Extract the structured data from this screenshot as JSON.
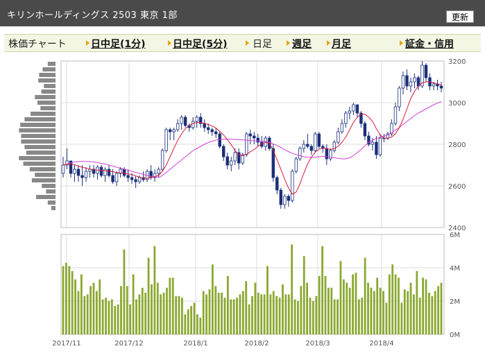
{
  "header": {
    "title": "キリンホールディングス  2503  東京 1部",
    "refresh_label": "更新"
  },
  "tabs": {
    "label": "株価チャート",
    "intraday_1": "日中足(1分)",
    "intraday_5": "日中足(5分)",
    "daily": "日足",
    "weekly": "週足",
    "monthly": "月足",
    "margin": "証金・信用"
  },
  "colors": {
    "up": "#ffffff",
    "down": "#1a2f7a",
    "ma_short": "#d81b3a",
    "ma_long": "#d13ed8",
    "volume": "#8aa830",
    "profile": "#888888"
  },
  "chart_data": {
    "type": "candlestick",
    "price_axis": {
      "ylim": [
        2400,
        3200
      ],
      "ticks": [
        "3200",
        "3000",
        "2800",
        "2600",
        "2400"
      ]
    },
    "volume_axis": {
      "ylim": [
        0,
        6000000
      ],
      "ticks": [
        "6M",
        "4M",
        "2M",
        "0M"
      ]
    },
    "x_ticks": [
      "2017/11",
      "2017/12",
      "2018/1",
      "2018/2",
      "2018/3",
      "2018/4"
    ],
    "ohlc": [
      [
        2660,
        2740,
        2640,
        2700
      ],
      [
        2700,
        2780,
        2680,
        2720
      ],
      [
        2720,
        2720,
        2640,
        2660
      ],
      [
        2660,
        2700,
        2620,
        2680
      ],
      [
        2680,
        2700,
        2620,
        2650
      ],
      [
        2650,
        2700,
        2600,
        2640
      ],
      [
        2640,
        2690,
        2620,
        2670
      ],
      [
        2670,
        2700,
        2640,
        2680
      ],
      [
        2680,
        2700,
        2640,
        2660
      ],
      [
        2660,
        2700,
        2630,
        2690
      ],
      [
        2690,
        2700,
        2640,
        2650
      ],
      [
        2650,
        2690,
        2620,
        2680
      ],
      [
        2680,
        2700,
        2640,
        2650
      ],
      [
        2650,
        2680,
        2610,
        2620
      ],
      [
        2620,
        2670,
        2600,
        2660
      ],
      [
        2660,
        2690,
        2640,
        2680
      ],
      [
        2680,
        2690,
        2640,
        2650
      ],
      [
        2650,
        2680,
        2620,
        2640
      ],
      [
        2640,
        2660,
        2610,
        2630
      ],
      [
        2630,
        2650,
        2590,
        2620
      ],
      [
        2620,
        2650,
        2610,
        2640
      ],
      [
        2640,
        2670,
        2620,
        2630
      ],
      [
        2630,
        2680,
        2620,
        2670
      ],
      [
        2670,
        2700,
        2630,
        2640
      ],
      [
        2640,
        2680,
        2620,
        2660
      ],
      [
        2660,
        2690,
        2640,
        2680
      ],
      [
        2680,
        2780,
        2670,
        2770
      ],
      [
        2770,
        2880,
        2760,
        2870
      ],
      [
        2870,
        2880,
        2820,
        2860
      ],
      [
        2860,
        2880,
        2820,
        2870
      ],
      [
        2870,
        2920,
        2860,
        2900
      ],
      [
        2900,
        2940,
        2870,
        2930
      ],
      [
        2930,
        2940,
        2880,
        2890
      ],
      [
        2890,
        2900,
        2860,
        2880
      ],
      [
        2880,
        2930,
        2870,
        2910
      ],
      [
        2910,
        2940,
        2880,
        2930
      ],
      [
        2930,
        2950,
        2880,
        2900
      ],
      [
        2900,
        2920,
        2860,
        2880
      ],
      [
        2880,
        2900,
        2850,
        2870
      ],
      [
        2870,
        2880,
        2840,
        2860
      ],
      [
        2860,
        2880,
        2830,
        2850
      ],
      [
        2850,
        2860,
        2780,
        2790
      ],
      [
        2790,
        2800,
        2720,
        2740
      ],
      [
        2740,
        2760,
        2680,
        2700
      ],
      [
        2700,
        2740,
        2670,
        2720
      ],
      [
        2720,
        2780,
        2700,
        2760
      ],
      [
        2760,
        2780,
        2680,
        2710
      ],
      [
        2710,
        2760,
        2700,
        2750
      ],
      [
        2750,
        2860,
        2740,
        2850
      ],
      [
        2850,
        2870,
        2800,
        2840
      ],
      [
        2840,
        2860,
        2800,
        2830
      ],
      [
        2830,
        2850,
        2790,
        2810
      ],
      [
        2810,
        2840,
        2780,
        2790
      ],
      [
        2790,
        2840,
        2770,
        2830
      ],
      [
        2830,
        2840,
        2770,
        2780
      ],
      [
        2780,
        2800,
        2620,
        2640
      ],
      [
        2640,
        2650,
        2560,
        2580
      ],
      [
        2580,
        2590,
        2490,
        2510
      ],
      [
        2510,
        2560,
        2490,
        2550
      ],
      [
        2550,
        2560,
        2500,
        2530
      ],
      [
        2530,
        2680,
        2520,
        2670
      ],
      [
        2670,
        2740,
        2660,
        2730
      ],
      [
        2730,
        2790,
        2720,
        2780
      ],
      [
        2780,
        2820,
        2760,
        2800
      ],
      [
        2800,
        2850,
        2780,
        2790
      ],
      [
        2790,
        2800,
        2750,
        2770
      ],
      [
        2770,
        2860,
        2760,
        2850
      ],
      [
        2850,
        2860,
        2780,
        2790
      ],
      [
        2790,
        2800,
        2760,
        2780
      ],
      [
        2780,
        2800,
        2700,
        2730
      ],
      [
        2730,
        2780,
        2720,
        2770
      ],
      [
        2770,
        2820,
        2760,
        2810
      ],
      [
        2810,
        2880,
        2800,
        2860
      ],
      [
        2860,
        2920,
        2850,
        2900
      ],
      [
        2900,
        2960,
        2880,
        2950
      ],
      [
        2950,
        2980,
        2920,
        2960
      ],
      [
        2960,
        3000,
        2940,
        2990
      ],
      [
        2990,
        2990,
        2930,
        2950
      ],
      [
        2950,
        2960,
        2880,
        2900
      ],
      [
        2900,
        2910,
        2820,
        2840
      ],
      [
        2840,
        2860,
        2790,
        2800
      ],
      [
        2800,
        2830,
        2770,
        2810
      ],
      [
        2810,
        2840,
        2730,
        2750
      ],
      [
        2750,
        2850,
        2740,
        2830
      ],
      [
        2830,
        2850,
        2810,
        2830
      ],
      [
        2830,
        2860,
        2820,
        2850
      ],
      [
        2850,
        2920,
        2840,
        2900
      ],
      [
        2900,
        3000,
        2890,
        2980
      ],
      [
        2980,
        3080,
        2960,
        3070
      ],
      [
        3070,
        3150,
        3040,
        3130
      ],
      [
        3130,
        3160,
        3060,
        3080
      ],
      [
        3080,
        3120,
        3050,
        3100
      ],
      [
        3100,
        3140,
        3070,
        3120
      ],
      [
        3120,
        3130,
        3060,
        3080
      ],
      [
        3080,
        3200,
        3070,
        3180
      ],
      [
        3180,
        3190,
        3100,
        3120
      ],
      [
        3120,
        3140,
        3060,
        3080
      ],
      [
        3080,
        3100,
        3060,
        3090
      ],
      [
        3090,
        3110,
        3060,
        3080
      ],
      [
        3080,
        3100,
        3050,
        3070
      ]
    ],
    "ma_short": [
      2700,
      2705,
      2705,
      2702,
      2695,
      2690,
      2685,
      2680,
      2678,
      2676,
      2675,
      2673,
      2671,
      2668,
      2665,
      2662,
      2660,
      2658,
      2655,
      2648,
      2642,
      2638,
      2636,
      2640,
      2645,
      2650,
      2670,
      2700,
      2740,
      2780,
      2820,
      2850,
      2875,
      2890,
      2900,
      2905,
      2905,
      2900,
      2895,
      2888,
      2878,
      2862,
      2845,
      2822,
      2798,
      2770,
      2750,
      2745,
      2752,
      2764,
      2775,
      2790,
      2802,
      2810,
      2805,
      2770,
      2725,
      2680,
      2632,
      2590,
      2560,
      2570,
      2610,
      2660,
      2705,
      2738,
      2762,
      2776,
      2782,
      2779,
      2775,
      2780,
      2790,
      2810,
      2835,
      2870,
      2905,
      2930,
      2945,
      2945,
      2930,
      2910,
      2875,
      2845,
      2830,
      2828,
      2835,
      2850,
      2880,
      2920,
      2970,
      3020,
      3055,
      3080,
      3095,
      3100,
      3100,
      3095,
      3090,
      3085
    ],
    "ma_long": [
      2700,
      2705,
      2710,
      2715,
      2717,
      2718,
      2718,
      2717,
      2715,
      2712,
      2708,
      2705,
      2700,
      2695,
      2690,
      2685,
      2680,
      2675,
      2670,
      2665,
      2660,
      2655,
      2650,
      2645,
      2642,
      2640,
      2650,
      2665,
      2680,
      2695,
      2710,
      2725,
      2740,
      2755,
      2770,
      2780,
      2790,
      2800,
      2808,
      2815,
      2820,
      2823,
      2825,
      2825,
      2824,
      2823,
      2822,
      2821,
      2820,
      2818,
      2817,
      2816,
      2815,
      2813,
      2810,
      2802,
      2794,
      2785,
      2774,
      2765,
      2756,
      2750,
      2745,
      2740,
      2738,
      2737,
      2738,
      2740,
      2742,
      2740,
      2738,
      2735,
      2732,
      2730,
      2730,
      2735,
      2745,
      2760,
      2775,
      2792,
      2810,
      2820,
      2828,
      2833,
      2838,
      2845,
      2855,
      2868,
      2880,
      2895,
      2910,
      2924,
      2938,
      2950,
      2960,
      2970,
      2980,
      2990,
      2998,
      3005
    ],
    "volume_m": [
      4.1,
      4.3,
      4.1,
      3.8,
      3.3,
      2.6,
      3.6,
      2.3,
      2.4,
      2.9,
      3.1,
      2.6,
      3.3,
      2.1,
      2.2,
      2.0,
      2.1,
      1.7,
      1.8,
      2.9,
      5.1,
      2.9,
      1.8,
      3.6,
      2.1,
      2.4,
      2.8,
      2.5,
      4.6,
      3.0,
      5.3,
      3.1,
      2.4,
      2.5,
      2.8,
      3.4,
      3.4,
      2.3,
      2.3,
      2.2,
      1.2,
      1.5,
      1.7,
      1.9,
      1.2,
      1.0,
      2.6,
      2.4,
      2.7,
      4.2,
      2.9,
      2.5,
      2.5,
      2.2,
      3.5,
      2.1,
      2.1,
      2.2,
      2.4,
      2.6,
      3.2,
      1.8,
      2.3,
      3.1,
      2.5,
      2.4,
      2.4,
      4.1,
      2.4,
      2.6,
      2.3,
      2.2,
      3.0,
      2.4,
      2.4,
      5.4,
      2.1,
      2.0,
      2.9,
      4.7,
      3.1,
      2.2,
      2.0,
      2.3,
      3.5,
      5.3,
      3.5,
      2.8,
      2.8,
      2.1,
      2.1,
      4.4,
      3.3,
      3.1,
      2.8,
      3.6,
      3.7,
      2.1,
      2.2,
      4.6
    ],
    "volume_tail_m": [
      3.1,
      2.8,
      2.6,
      3.4,
      2.8,
      2.6,
      1.9,
      3.6,
      4.2,
      3.6,
      3.4,
      1.9,
      2.7,
      2.6,
      3.1,
      2.4,
      3.8,
      2.2,
      3.4,
      3.3,
      2.5,
      2.3,
      2.6,
      2.9,
      3.1
    ],
    "volume_profile": [
      0.18,
      0.3,
      0.38,
      0.4,
      0.27,
      0.33,
      0.48,
      0.42,
      0.35,
      0.58,
      0.72,
      0.82,
      0.85,
      0.8,
      0.8,
      0.72,
      0.68,
      0.85,
      0.75,
      0.6,
      0.48,
      0.55,
      0.32,
      0.22,
      0.45,
      0.18,
      0.1
    ]
  }
}
